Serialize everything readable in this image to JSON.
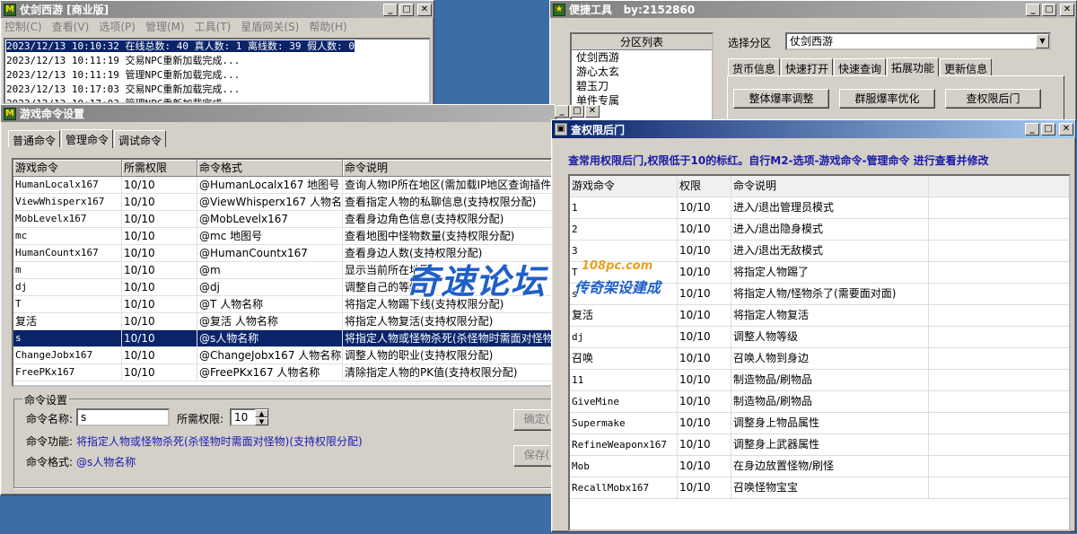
{
  "main_window": {
    "title": "仗剑西游 [商业版]",
    "menu": [
      "控制(C)",
      "查看(V)",
      "选项(P)",
      "管理(M)",
      "工具(T)",
      "星盾网关(S)",
      "帮助(H)"
    ],
    "log_lines": [
      "2023/12/13 10:10:32 在线总数: 40 真人数: 1 离线数: 39 假人数: 0",
      "2023/12/13 10:11:19 交易NPC重新加载完成...",
      "2023/12/13 10:11:19 管理NPC重新加载完成...",
      "2023/12/13 10:17:03 交易NPC重新加载完成...",
      "2023/12/13 10:17:03 管理NPC重新加载完成..."
    ]
  },
  "tools_window": {
    "title": "便捷工具",
    "author": "by:2152860",
    "partition_list_header": "分区列表",
    "partitions": [
      "仗剑西游",
      "游心太玄",
      "碧玉刀",
      "单件专属"
    ],
    "select_label": "选择分区",
    "selected_partition": "仗剑西游",
    "tabs": [
      "货币信息",
      "快速打开",
      "快速查询",
      "拓展功能",
      "更新信息"
    ],
    "active_tab": 3,
    "buttons": [
      "整体爆率调整",
      "群服爆率优化",
      "查权限后门"
    ]
  },
  "command_window": {
    "title": "游戏命令设置",
    "tabs": [
      "普通命令",
      "管理命令",
      "调试命令"
    ],
    "active_tab": 1,
    "columns": [
      "游戏命令",
      "所需权限",
      "命令格式",
      "命令说明"
    ],
    "rows": [
      [
        "HumanLocalx167",
        "10/10",
        "@HumanLocalx167 地图号",
        "查询人物IP所在地区(需加载IP地区查询插件)"
      ],
      [
        "ViewWhisperx167",
        "10/10",
        "@ViewWhisperx167 人物名称",
        "查看指定人物的私聊信息(支持权限分配)"
      ],
      [
        "MobLevelx167",
        "10/10",
        "@MobLevelx167",
        "查看身边角色信息(支持权限分配)"
      ],
      [
        "mc",
        "10/10",
        "@mc 地图号",
        "查看地图中怪物数量(支持权限分配)"
      ],
      [
        "HumanCountx167",
        "10/10",
        "@HumanCountx167",
        "查看身边人数(支持权限分配)"
      ],
      [
        "m",
        "10/10",
        "@m",
        "显示当前所在地图"
      ],
      [
        "dj",
        "10/10",
        "@dj",
        "调整自己的等级"
      ],
      [
        "T",
        "10/10",
        "@T 人物名称",
        "将指定人物踢下线(支持权限分配)"
      ],
      [
        "复活",
        "10/10",
        "@复活 人物名称",
        "将指定人物复活(支持权限分配)"
      ],
      [
        "s",
        "10/10",
        "@s人物名称",
        "将指定人物或怪物杀死(杀怪物时需面对怪物)"
      ],
      [
        "ChangeJobx167",
        "10/10",
        "@ChangeJobx167 人物名称 职业",
        "调整人物的职业(支持权限分配)"
      ],
      [
        "FreePKx167",
        "10/10",
        "@FreePKx167 人物名称",
        "清除指定人物的PK值(支持权限分配)"
      ]
    ],
    "selected_row": 9,
    "settings_group": "命令设置",
    "name_label": "命令名称:",
    "name_value": "s",
    "perm_label": "所需权限:",
    "perm_value": "10",
    "func_label": "命令功能:",
    "func_value": "将指定人物或怪物杀死(杀怪物时需面对怪物)(支持权限分配)",
    "format_label": "命令格式:",
    "format_value": "@s人物名称",
    "ok_button": "确定(",
    "save_button": "保存("
  },
  "perm_window": {
    "title": "查权限后门",
    "notice": "查常用权限后门,权限低于10的标红。自行M2-选项-游戏命令-管理命令 进行查看并修改",
    "columns": [
      "游戏命令",
      "权限",
      "命令说明"
    ],
    "rows": [
      [
        "1",
        "10/10",
        "进入/退出管理员模式"
      ],
      [
        "2",
        "10/10",
        "进入/退出隐身模式"
      ],
      [
        "3",
        "10/10",
        "进入/退出无敌模式"
      ],
      [
        "T",
        "10/10",
        "将指定人物踢了"
      ],
      [
        "s",
        "10/10",
        "将指定人物/怪物杀了(需要面对面)"
      ],
      [
        "复活",
        "10/10",
        "将指定人物复活"
      ],
      [
        "dj",
        "10/10",
        "调整人物等级"
      ],
      [
        "召唤",
        "10/10",
        "召唤人物到身边"
      ],
      [
        "11",
        "10/10",
        "制造物品/刷物品"
      ],
      [
        "GiveMine",
        "10/10",
        "制造物品/刷物品"
      ],
      [
        "Supermake",
        "10/10",
        "调整身上物品属性"
      ],
      [
        "RefineWeaponx167",
        "10/10",
        "调整身上武器属性"
      ],
      [
        "Mob",
        "10/10",
        "在身边放置怪物/刷怪"
      ],
      [
        "RecallMobx167",
        "10/10",
        "召唤怪物宝宝"
      ]
    ]
  },
  "watermark": {
    "main": "奇速论坛",
    "domain": "108pc.com",
    "sub": "传奇架设建成"
  }
}
